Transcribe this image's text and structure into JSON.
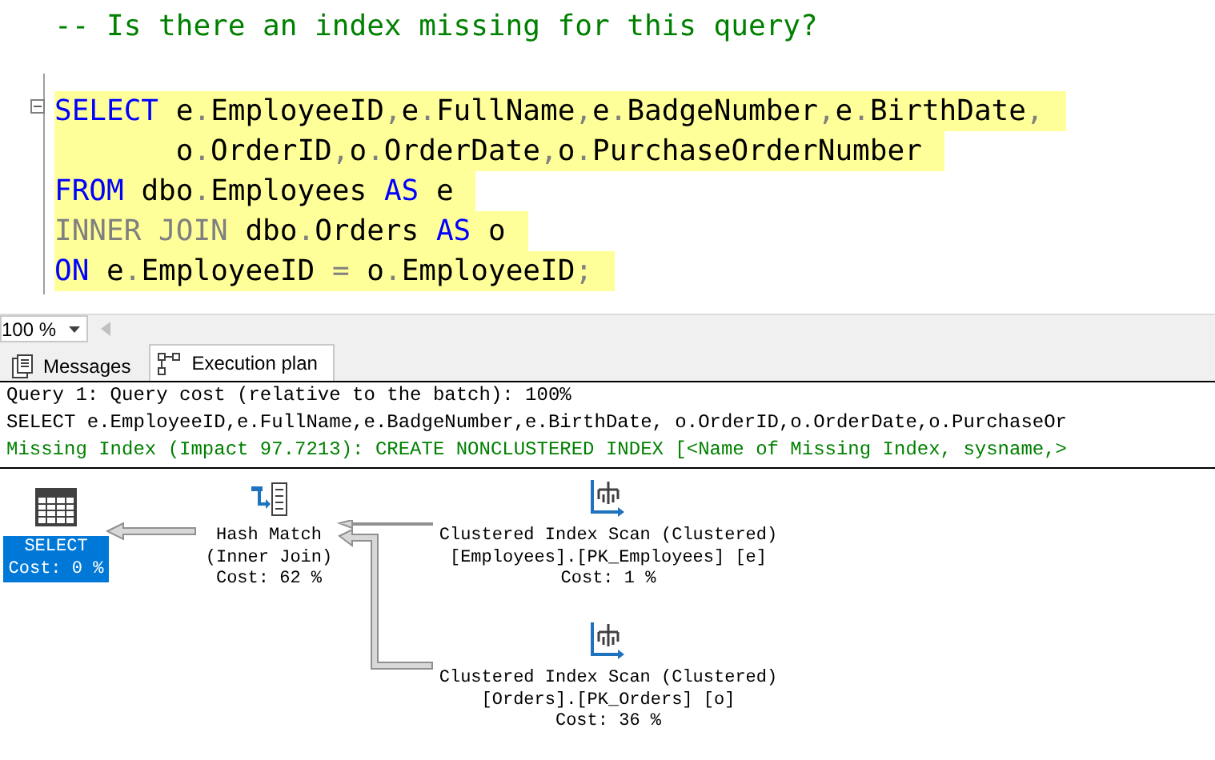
{
  "editor": {
    "comment": "-- Is there an index missing for this query?",
    "lines": [
      {
        "highlighted": true,
        "tokens": [
          {
            "kind": "keyword",
            "text": "SELECT"
          },
          {
            "kind": "text",
            "text": " e"
          },
          {
            "kind": "operator",
            "text": "."
          },
          {
            "kind": "text",
            "text": "EmployeeID"
          },
          {
            "kind": "operator",
            "text": ","
          },
          {
            "kind": "text",
            "text": "e"
          },
          {
            "kind": "operator",
            "text": "."
          },
          {
            "kind": "text",
            "text": "FullName"
          },
          {
            "kind": "operator",
            "text": ","
          },
          {
            "kind": "text",
            "text": "e"
          },
          {
            "kind": "operator",
            "text": "."
          },
          {
            "kind": "text",
            "text": "BadgeNumber"
          },
          {
            "kind": "operator",
            "text": ","
          },
          {
            "kind": "text",
            "text": "e"
          },
          {
            "kind": "operator",
            "text": "."
          },
          {
            "kind": "text",
            "text": "BirthDate"
          },
          {
            "kind": "operator",
            "text": ","
          }
        ]
      },
      {
        "highlighted": true,
        "continuation": true,
        "tokens": [
          {
            "kind": "text",
            "text": "o"
          },
          {
            "kind": "operator",
            "text": "."
          },
          {
            "kind": "text",
            "text": "OrderID"
          },
          {
            "kind": "operator",
            "text": ","
          },
          {
            "kind": "text",
            "text": "o"
          },
          {
            "kind": "operator",
            "text": "."
          },
          {
            "kind": "text",
            "text": "OrderDate"
          },
          {
            "kind": "operator",
            "text": ","
          },
          {
            "kind": "text",
            "text": "o"
          },
          {
            "kind": "operator",
            "text": "."
          },
          {
            "kind": "text",
            "text": "PurchaseOrderNumber"
          }
        ]
      },
      {
        "highlighted": true,
        "tokens": [
          {
            "kind": "keyword",
            "text": "FROM"
          },
          {
            "kind": "text",
            "text": " dbo"
          },
          {
            "kind": "operator",
            "text": "."
          },
          {
            "kind": "text",
            "text": "Employees "
          },
          {
            "kind": "keyword",
            "text": "AS"
          },
          {
            "kind": "text",
            "text": " e"
          }
        ]
      },
      {
        "highlighted": true,
        "tokens": [
          {
            "kind": "operator",
            "text": "INNER JOIN"
          },
          {
            "kind": "text",
            "text": " dbo"
          },
          {
            "kind": "operator",
            "text": "."
          },
          {
            "kind": "text",
            "text": "Orders "
          },
          {
            "kind": "keyword",
            "text": "AS"
          },
          {
            "kind": "text",
            "text": " o"
          }
        ]
      },
      {
        "highlighted": true,
        "tokens": [
          {
            "kind": "keyword",
            "text": "ON"
          },
          {
            "kind": "text",
            "text": " e"
          },
          {
            "kind": "operator",
            "text": "."
          },
          {
            "kind": "text",
            "text": "EmployeeID "
          },
          {
            "kind": "operator",
            "text": "="
          },
          {
            "kind": "text",
            "text": " o"
          },
          {
            "kind": "operator",
            "text": "."
          },
          {
            "kind": "text",
            "text": "EmployeeID"
          },
          {
            "kind": "operator",
            "text": ";"
          }
        ]
      }
    ]
  },
  "zoom": {
    "value": "100 %"
  },
  "tabs": [
    {
      "label": "Messages",
      "selected": false,
      "kind": "messages"
    },
    {
      "label": "Execution plan",
      "selected": true,
      "kind": "plan"
    }
  ],
  "results": [
    {
      "kind": "info",
      "text": "Query 1: Query cost (relative to the batch): 100%"
    },
    {
      "kind": "info",
      "text": "SELECT e.EmployeeID,e.FullName,e.BadgeNumber,e.BirthDate, o.OrderID,o.OrderDate,o.PurchaseOr"
    },
    {
      "kind": "missing_index",
      "text": "Missing Index (Impact 97.7213): CREATE NONCLUSTERED INDEX [<Name of Missing Index, sysname,>"
    }
  ],
  "plan": {
    "nodes": [
      {
        "kind": "select",
        "selected": true,
        "lines": [
          "SELECT",
          "Cost: 0 %"
        ]
      },
      {
        "kind": "hash_match",
        "selected": false,
        "lines": [
          "Hash Match",
          "(Inner Join)",
          "Cost: 62 %"
        ]
      },
      {
        "kind": "index_scan",
        "selected": false,
        "lines": [
          "Clustered Index Scan (Clustered)",
          "[Employees].[PK_Employees] [e]",
          "Cost: 1 %"
        ]
      },
      {
        "kind": "index_scan",
        "selected": false,
        "lines": [
          "Clustered Index Scan (Clustered)",
          "[Orders].[PK_Orders] [o]",
          "Cost: 36 %"
        ]
      }
    ]
  }
}
